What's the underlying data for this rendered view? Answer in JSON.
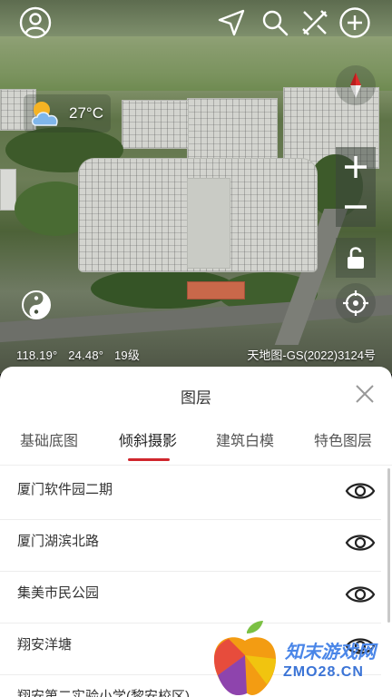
{
  "map": {
    "weather": {
      "temperature": "27°C",
      "icon": "partly-cloudy-icon"
    },
    "coordinates": {
      "longitude": "118.19°",
      "latitude": "24.48°",
      "zoom": "19级"
    },
    "copyright": "天地图-GS(2022)3124号",
    "toolbar": [
      "user-icon",
      "navigate-icon",
      "search-icon",
      "measure-icon",
      "add-icon"
    ],
    "controls": [
      "compass-icon",
      "zoom-in-icon",
      "zoom-out-icon",
      "lock-icon",
      "locate-icon"
    ]
  },
  "layers_panel": {
    "title": "图层",
    "tabs": [
      {
        "label": "基础底图"
      },
      {
        "label": "倾斜摄影",
        "active": true
      },
      {
        "label": "建筑白模"
      },
      {
        "label": "特色图层"
      }
    ],
    "items": [
      {
        "label": "厦门软件园二期"
      },
      {
        "label": "厦门湖滨北路"
      },
      {
        "label": "集美市民公园"
      },
      {
        "label": "翔安洋塘"
      },
      {
        "label": "翔安第二实验小学(黎安校区)"
      }
    ]
  },
  "watermark": {
    "name": "知末游戏网",
    "url": "ZMO28.CN"
  },
  "colors": {
    "accent": "#d0262d",
    "text": "#333333",
    "watermark": "#4a86e8"
  }
}
